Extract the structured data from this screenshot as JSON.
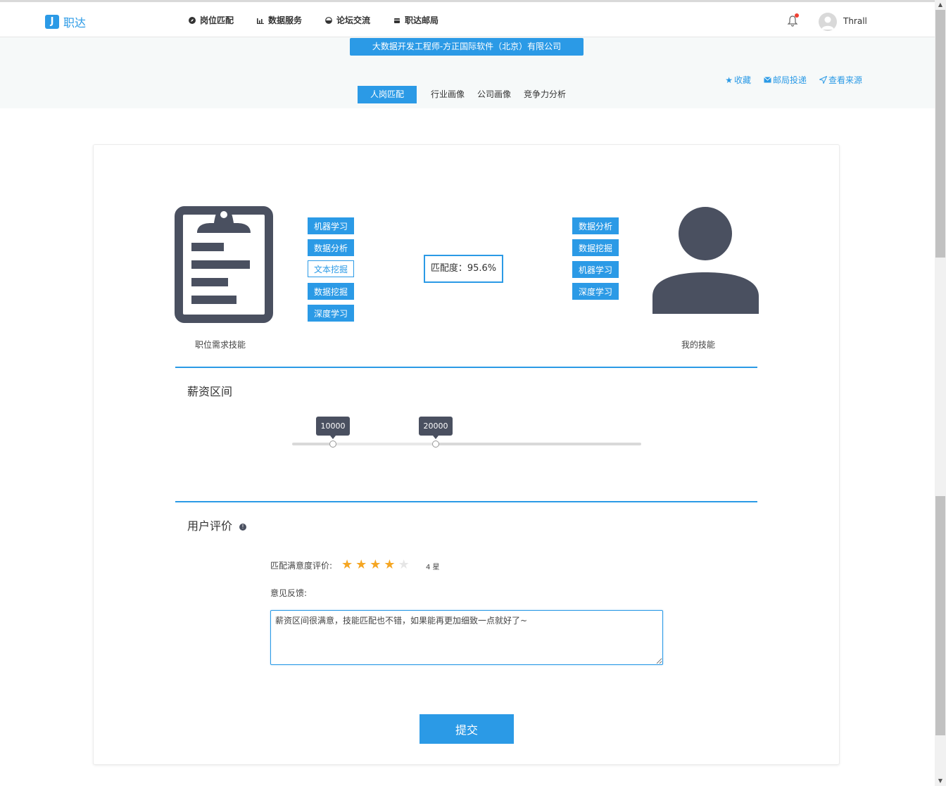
{
  "brand": {
    "name": "职达",
    "mark": "J",
    "color": "#2b9ae6"
  },
  "nav": [
    {
      "label": "岗位匹配",
      "icon": "compass-icon"
    },
    {
      "label": "数据服务",
      "icon": "bar-chart-icon"
    },
    {
      "label": "论坛交流",
      "icon": "chat-icon"
    },
    {
      "label": "职达邮局",
      "icon": "mailbox-icon"
    }
  ],
  "user": {
    "name": "Thrall"
  },
  "job": {
    "title": "大数据开发工程师-方正国际软件（北京）有限公司"
  },
  "actions": [
    {
      "label": "收藏",
      "icon": "star-icon"
    },
    {
      "label": "邮局投递",
      "icon": "envelope-icon"
    },
    {
      "label": "查看来源",
      "icon": "send-icon"
    }
  ],
  "tabs": [
    {
      "label": "人岗匹配",
      "active": true
    },
    {
      "label": "行业画像"
    },
    {
      "label": "公司画像"
    },
    {
      "label": "竞争力分析"
    }
  ],
  "match": {
    "job_skills_caption": "职位需求技能",
    "my_skills_caption": "我的技能",
    "job_skills": [
      {
        "label": "机器学习"
      },
      {
        "label": "数据分析"
      },
      {
        "label": "文本挖掘",
        "style": "outline"
      },
      {
        "label": "数据挖掘"
      },
      {
        "label": "深度学习"
      }
    ],
    "my_skills": [
      {
        "label": "数据分析"
      },
      {
        "label": "数据挖掘"
      },
      {
        "label": "机器学习"
      },
      {
        "label": "深度学习"
      }
    ],
    "score_text": "匹配度：95.6%"
  },
  "salary": {
    "title": "薪资区间",
    "low": "10000",
    "high": "20000"
  },
  "review": {
    "title": "用户评价",
    "rating_label": "匹配满意度评价:",
    "rating": 4,
    "max_rating": 5,
    "rating_text": "4 星",
    "feedback_label": "意见反馈:",
    "feedback_value": "薪资区间很满意，技能匹配也不错，如果能再更加细致一点就好了~",
    "submit_label": "提交"
  }
}
